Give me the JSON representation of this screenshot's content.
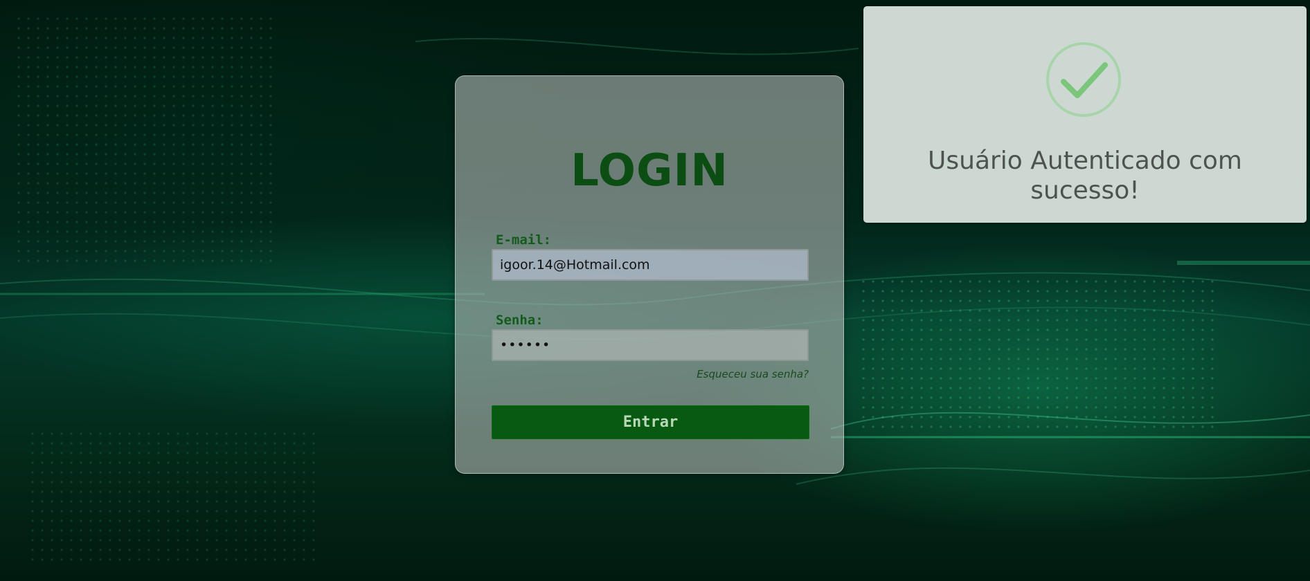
{
  "login": {
    "title": "LOGIN",
    "email_label": "E-mail:",
    "email_value": "igoor.14@Hotmail.com",
    "password_label": "Senha:",
    "password_value": "••••••",
    "forgot_link": "Esqueceu sua senha?",
    "submit_label": "Entrar"
  },
  "toast": {
    "icon": "check-circle-icon",
    "message": "Usuário Autenticado com sucesso!"
  },
  "colors": {
    "accent_green": "#075a10",
    "title_green": "#0b4d12",
    "success_green": "#7cc67c",
    "background": "#02261a"
  }
}
